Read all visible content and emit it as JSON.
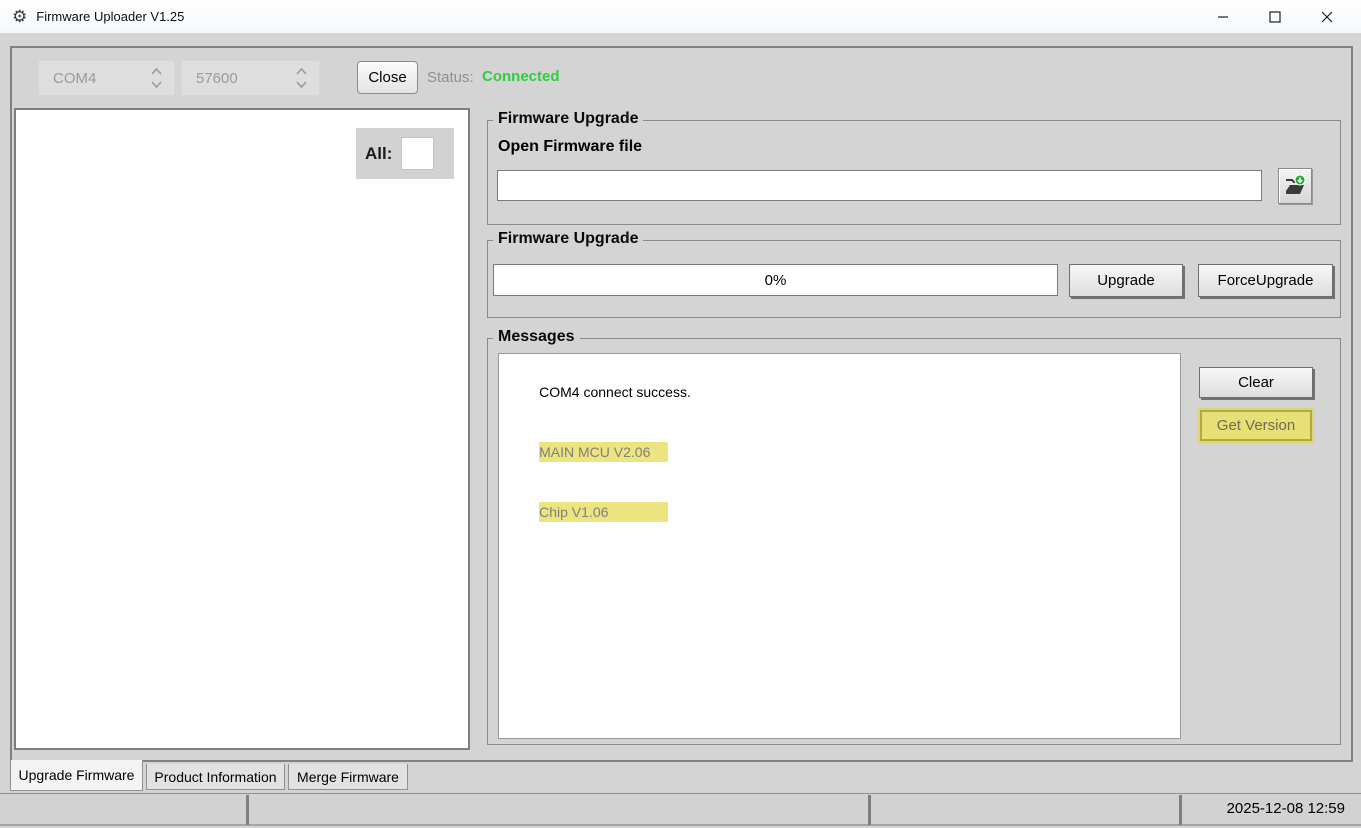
{
  "window": {
    "title": "Firmware Uploader V1.25"
  },
  "toolbar": {
    "port_value": "COM4",
    "baud_value": "57600",
    "close_label": "Close",
    "status_label": "Status:",
    "status_value": "Connected"
  },
  "device_panel": {
    "all_label": "All:",
    "all_checked": false
  },
  "file_group": {
    "title": "Firmware Upgrade",
    "open_label": "Open Firmware file",
    "file_path": ""
  },
  "upgrade_group": {
    "title": "Firmware Upgrade",
    "progress_text": "0%",
    "upgrade_label": "Upgrade",
    "force_upgrade_label": "ForceUpgrade"
  },
  "messages_group": {
    "title": "Messages",
    "lines": [
      {
        "text": "COM4 connect success.",
        "highlighted": false
      },
      {
        "text": "MAIN MCU V2.06",
        "highlighted": true
      },
      {
        "text": "Chip V1.06",
        "highlighted": true
      }
    ],
    "clear_label": "Clear",
    "get_version_label": "Get Version"
  },
  "tabs": [
    {
      "label": "Upgrade Firmware",
      "active": true
    },
    {
      "label": "Product Information",
      "active": false
    },
    {
      "label": "Merge Firmware",
      "active": false
    }
  ],
  "statusbar": {
    "datetime": "2025-12-08 12:59"
  },
  "icons": {
    "titlebar": "gear-icon",
    "combo": "chevron-updown-icon",
    "open_file": "open-folder-icon"
  },
  "colors": {
    "status_connected": "#2fce41",
    "message_highlight": "#ece47f",
    "get_version_highlight": "#e8e074",
    "background": "#d4d4d4"
  }
}
